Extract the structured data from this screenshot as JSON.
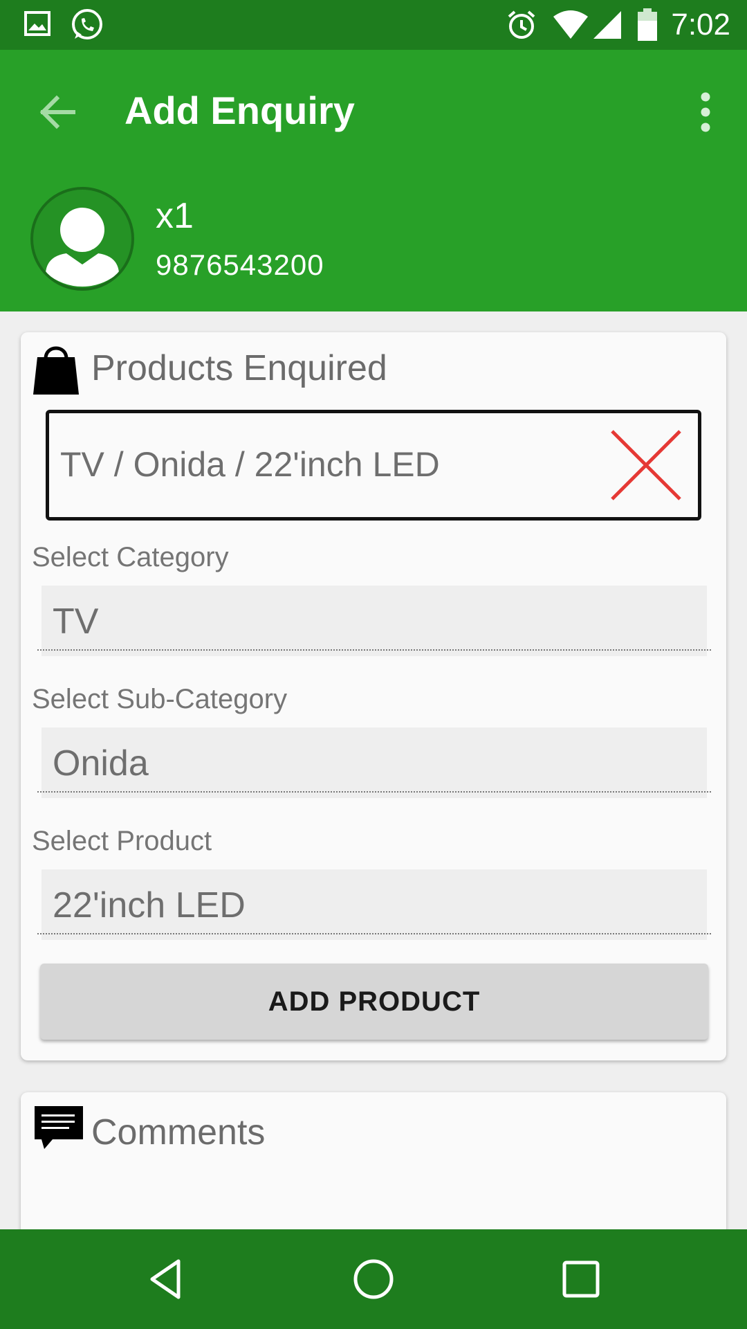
{
  "status_bar": {
    "time": "7:02",
    "icons": [
      "image-icon",
      "whatsapp-icon",
      "alarm-icon",
      "wifi-icon",
      "signal-icon",
      "battery-icon"
    ]
  },
  "app_bar": {
    "title": "Add Enquiry",
    "back_icon": "arrow-back-icon",
    "menu_icon": "more-vert-icon"
  },
  "contact": {
    "name": "x1",
    "phone": "9876543200",
    "avatar_icon": "person-icon"
  },
  "products_card": {
    "heading": "Products Enquired",
    "heading_icon": "shopping-bag-icon",
    "selected_product": "TV / Onida / 22'inch LED",
    "remove_icon": "close-icon",
    "category_label": "Select Category",
    "category_value": "TV",
    "subcategory_label": "Select Sub-Category",
    "subcategory_value": "Onida",
    "product_label": "Select Product",
    "product_value": "22'inch LED",
    "add_button_label": "ADD PRODUCT"
  },
  "comments_card": {
    "heading": "Comments",
    "heading_icon": "comment-icon"
  },
  "nav_bar": {
    "icons": [
      "nav-back-icon",
      "nav-home-icon",
      "nav-recents-icon"
    ]
  },
  "colors": {
    "primary": "#28a028",
    "primary_dark": "#1e7d1e",
    "remove_red": "#e53935"
  }
}
